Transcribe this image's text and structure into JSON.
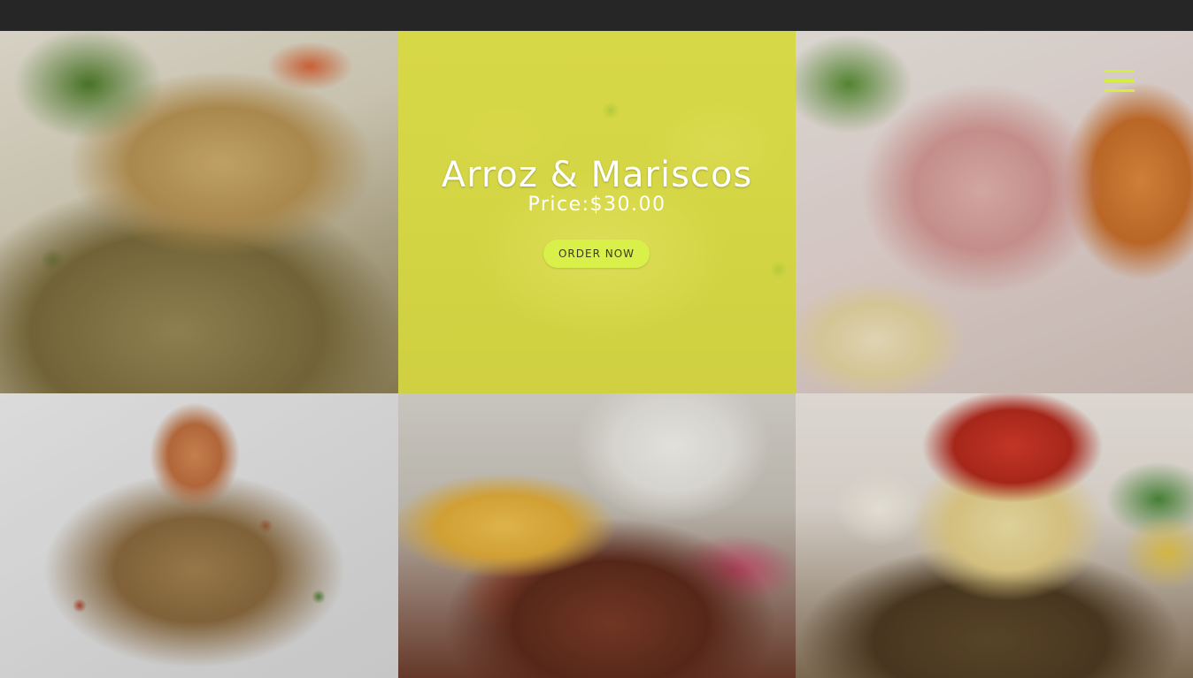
{
  "menu": {
    "icon": "hamburger-menu-icon",
    "accent_color": "#d6ee3f"
  },
  "featured_item": {
    "title": "Arroz & Mariscos",
    "price": "Price:$30.00",
    "order_label": "ORDER NOW",
    "highlight_color": "#deea3c",
    "button_color": "#d9f04b"
  },
  "tiles": [
    {
      "name": "tile-chicken-rice",
      "image": "chicken-with-green-rice"
    },
    {
      "name": "tile-arroz-mariscos",
      "image": "seafood-rice"
    },
    {
      "name": "tile-ceviche",
      "image": "fish-ceviche"
    },
    {
      "name": "tile-fried-rice",
      "image": "chaufa-fried-rice"
    },
    {
      "name": "tile-lomo-saltado",
      "image": "beef-stir-fry-with-rice"
    },
    {
      "name": "tile-stuffed-pepper",
      "image": "stuffed-pepper"
    }
  ]
}
